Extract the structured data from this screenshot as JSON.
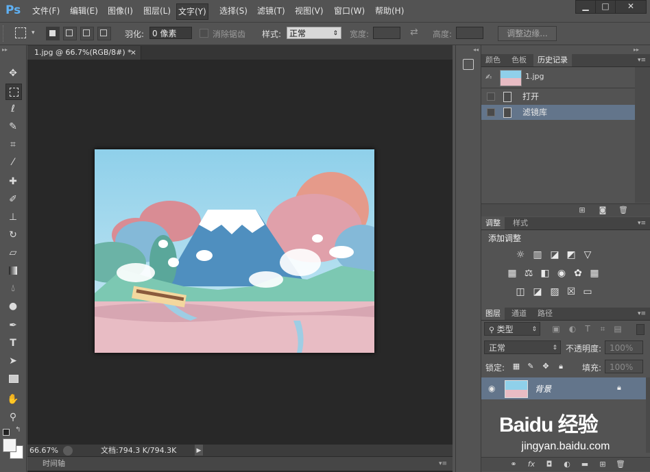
{
  "app": {
    "logo": "Ps"
  },
  "menu": [
    "文件(F)",
    "编辑(E)",
    "图像(I)",
    "图层(L)",
    "文字(Y)",
    "选择(S)",
    "滤镜(T)",
    "视图(V)",
    "窗口(W)",
    "帮助(H)"
  ],
  "window_buttons": [
    "▁",
    "□",
    "✕"
  ],
  "options": {
    "feather_label": "羽化:",
    "feather_value": "0 像素",
    "antialias_label": "消除锯齿",
    "style_label": "样式:",
    "style_value": "正常",
    "width_label": "宽度:",
    "height_label": "高度:",
    "refine_button": "调整边缘..."
  },
  "document": {
    "tab_title": "1.jpg @ 66.7%(RGB/8#) *",
    "tab_close": "×",
    "zoom": "66.67%",
    "doc_info": "文档:794.3 K/794.3K",
    "timeline_label": "时间轴"
  },
  "history_panel": {
    "tabs": [
      "颜色",
      "色板",
      "历史记录"
    ],
    "snapshot_name": "1.jpg",
    "items": [
      "打开",
      "滤镜库"
    ]
  },
  "adjustments_panel": {
    "tabs": [
      "调整",
      "样式"
    ],
    "title": "添加调整"
  },
  "layers_panel": {
    "tabs": [
      "图层",
      "通道",
      "路径"
    ],
    "filter_kind": "类型",
    "blend_mode": "正常",
    "opacity_label": "不透明度:",
    "opacity_value": "100%",
    "lock_label": "锁定:",
    "fill_label": "填充:",
    "fill_value": "100%",
    "layer_name": "背景"
  },
  "watermark": {
    "brand": "Baidu 经验",
    "url": "jingyan.baidu.com"
  },
  "colors": {
    "ui_bg": "#535353",
    "canvas_bg": "#282828",
    "selection": "#63758b",
    "ps_blue": "#5fb1f4"
  }
}
